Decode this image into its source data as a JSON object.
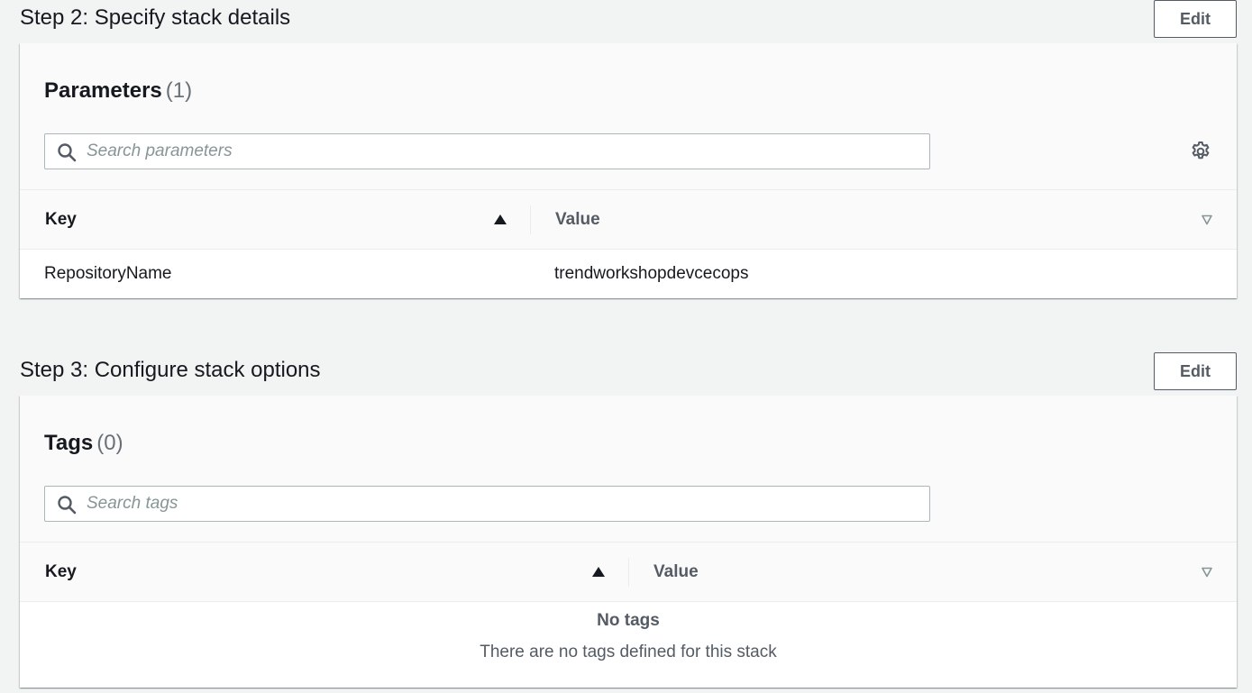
{
  "step2": {
    "title": "Step 2: Specify stack details",
    "edit_label": "Edit",
    "panel": {
      "title": "Parameters",
      "count": "(1)",
      "search_placeholder": "Search parameters",
      "columns": {
        "key": "Key",
        "value": "Value"
      },
      "rows": [
        {
          "key": "RepositoryName",
          "value": "trendworkshopdevcecops"
        }
      ]
    }
  },
  "step3": {
    "title": "Step 3: Configure stack options",
    "edit_label": "Edit",
    "panel": {
      "title": "Tags",
      "count": "(0)",
      "search_placeholder": "Search tags",
      "columns": {
        "key": "Key",
        "value": "Value"
      },
      "empty_title": "No tags",
      "empty_description": "There are no tags defined for this stack"
    }
  },
  "icons": {
    "search": "search-icon",
    "settings": "gear-icon",
    "sort_ascending": "sort-ascending-icon",
    "sort_descending": "sort-descending-icon"
  },
  "colors": {
    "page_background": "#f2f3f3",
    "panel_header": "#fafafa",
    "text_primary": "#16191f",
    "text_secondary": "#545b64",
    "placeholder": "#879596"
  }
}
